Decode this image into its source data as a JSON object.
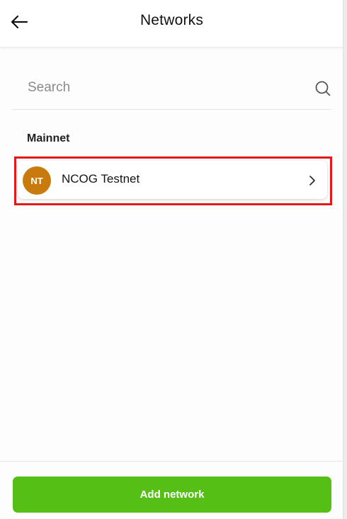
{
  "header": {
    "title": "Networks",
    "back_icon": "arrow-left-icon"
  },
  "search": {
    "placeholder": "Search",
    "value": "",
    "icon": "search-icon"
  },
  "section": {
    "label": "Mainnet"
  },
  "networks": [
    {
      "initials": "NT",
      "name": "NCOG Testnet",
      "avatar_color": "#c97a0c",
      "chevron_icon": "chevron-right-icon",
      "highlighted": true
    }
  ],
  "footer": {
    "add_label": "Add network",
    "button_color": "#56bf16"
  },
  "colors": {
    "highlight_border": "#e01a1a"
  }
}
